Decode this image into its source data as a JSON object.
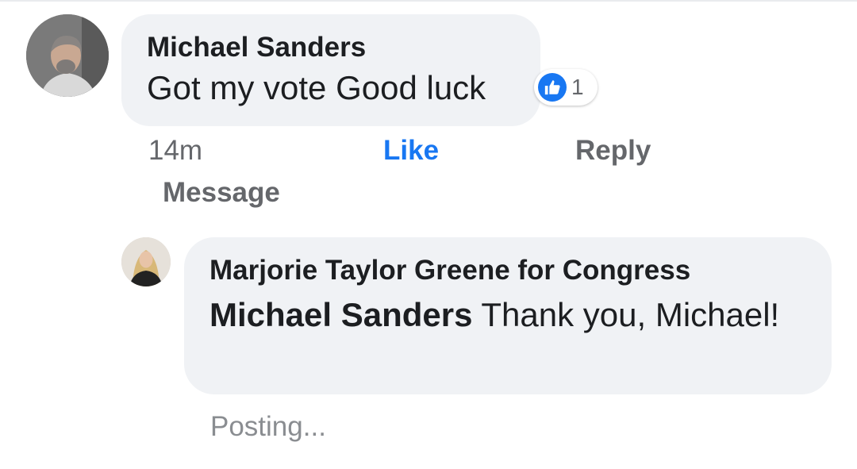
{
  "comment": {
    "author": "Michael Sanders",
    "text": "Got my vote Good luck",
    "reaction_count": "1",
    "reaction_icon": "thumbs-up-icon",
    "time": "14m",
    "like_label": "Like",
    "reply_label": "Reply",
    "message_label": "Message"
  },
  "reply": {
    "author": "Marjorie Taylor Greene for Congress",
    "mention": "Michael Sanders",
    "text": " Thank you, Michael!",
    "status": "Posting..."
  },
  "colors": {
    "bubble_bg": "#f0f2f5",
    "accent_blue": "#1877f2",
    "meta_gray": "#65676b",
    "posting_gray": "#8a8d91",
    "text_dark": "#1c1e21"
  }
}
